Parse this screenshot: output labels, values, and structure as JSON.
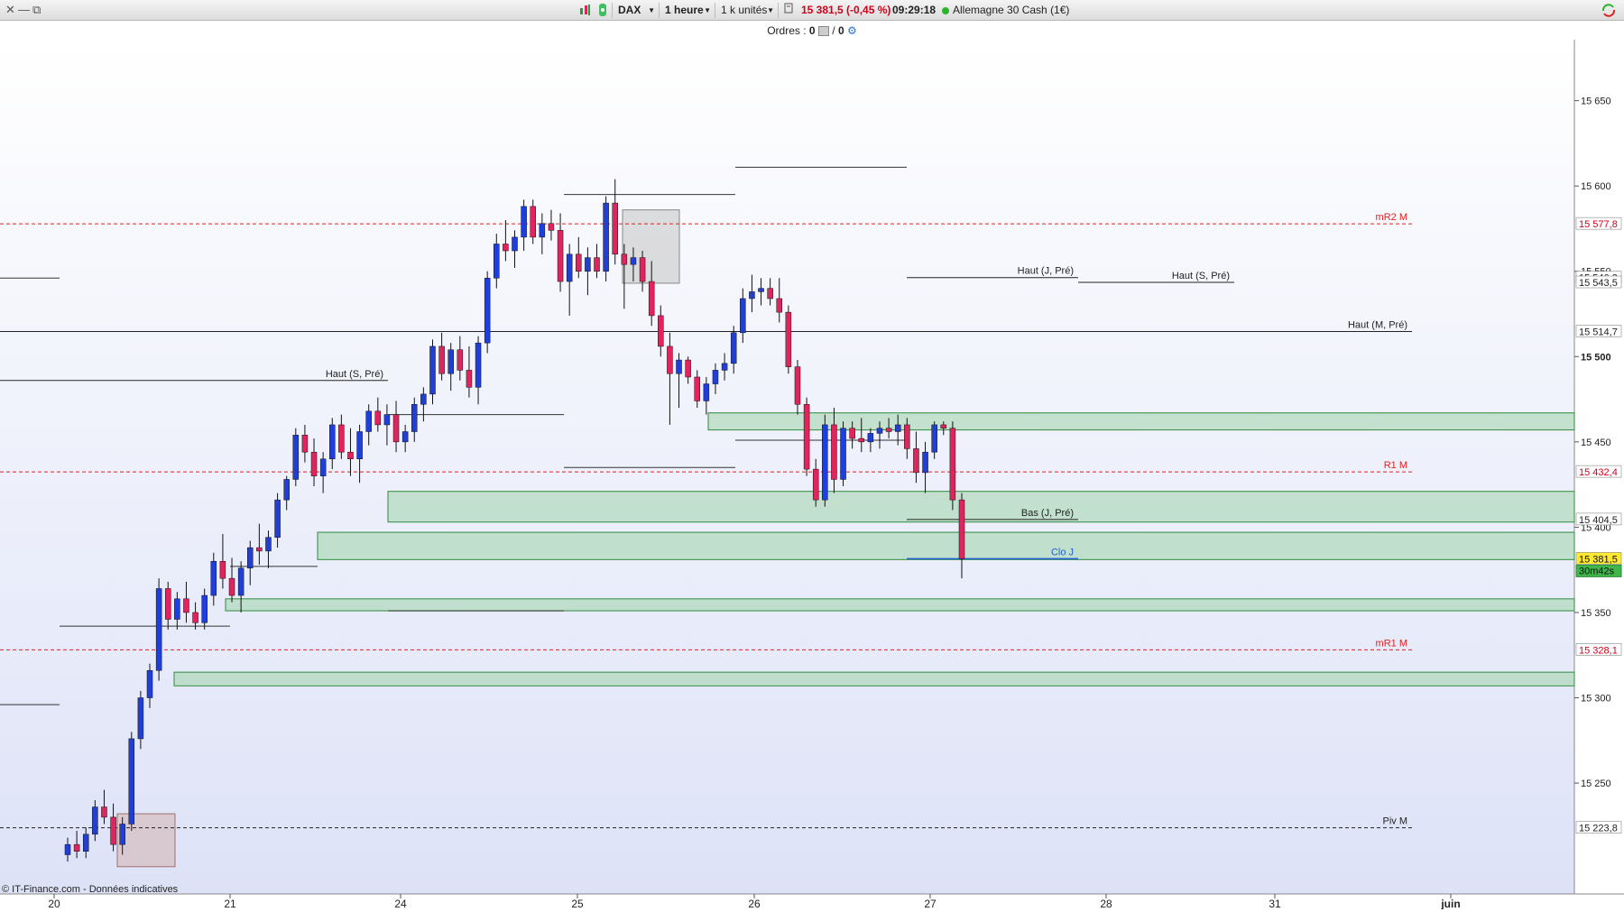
{
  "toolbar": {
    "close_glyph": "✕",
    "minimize_glyph": "—",
    "restore_glyph": "⧉",
    "symbol": "DAX",
    "timeframe": "1 heure",
    "units": "1 k unités",
    "last_quote": "15 381,5 (-0,45 %)",
    "time": "09:29:18",
    "instrument": "Allemagne 30 Cash (1€)",
    "status_color": "#2bb42b",
    "negative_color": "#d0021b"
  },
  "orders": {
    "label": "Ordres :",
    "count_a": "0",
    "separator": "/",
    "count_b": "0"
  },
  "copyright": "© IT-Finance.com - Données indicatives",
  "colors": {
    "bull": "#1f3fd8",
    "bear": "#e0245e",
    "zone_fill": "#9fd3a8",
    "zone_stroke": "#2e8b3e",
    "pivot": "#e02020",
    "level": "#222222",
    "close": "#1f5fd8",
    "bg_top": "#ffffff",
    "bg_bottom": "#dde2f7"
  },
  "chart_data": {
    "type": "candlestick",
    "instrument": "DAX",
    "timeframe": "1 heure",
    "x_tick_labels": [
      "20",
      "21",
      "24",
      "25",
      "26",
      "27",
      "28",
      "31",
      "juin"
    ],
    "y_tick_labels": [
      "15 650",
      "15 600",
      "15 550",
      "15 500",
      "15 450",
      "15 400",
      "15 350",
      "15 300",
      "15 250"
    ],
    "y_axis_visible_range": [
      15200,
      15670
    ],
    "price_tags": [
      {
        "value": "15 577,8",
        "kind": "pivot"
      },
      {
        "value": "15 546,3",
        "kind": "level"
      },
      {
        "value": "15 543,5",
        "kind": "level"
      },
      {
        "value": "15 514,7",
        "kind": "level"
      },
      {
        "value": "15 432,4",
        "kind": "pivot"
      },
      {
        "value": "15 404,5",
        "kind": "level"
      },
      {
        "value": "15 381,5",
        "kind": "last"
      },
      {
        "value": "15 328,1",
        "kind": "pivot"
      },
      {
        "value": "15 223,8",
        "kind": "level"
      }
    ],
    "countdown": "30m42s",
    "levels": [
      {
        "label": "mR2 M",
        "price": 15577.8,
        "style": "pivot"
      },
      {
        "label": "R1 M",
        "price": 15432.4,
        "style": "pivot"
      },
      {
        "label": "mR1 M",
        "price": 15328.1,
        "style": "pivot"
      },
      {
        "label": "Piv M",
        "price": 15223.8,
        "style": "level"
      },
      {
        "label": "Haut (M, Pré)",
        "price": 15514.7,
        "style": "level"
      },
      {
        "label": "Haut (J, Pré)",
        "price": 15546.3,
        "style": "level"
      },
      {
        "label": "Haut (S, Pré)",
        "price": 15543.5,
        "style": "level"
      },
      {
        "label": "Haut (S, Pré)",
        "price": 15486,
        "style": "level"
      },
      {
        "label": "Bas (J, Pré)",
        "price": 15404.5,
        "style": "level"
      },
      {
        "label": "Clo J",
        "price": 15381.5,
        "style": "close"
      }
    ],
    "zones": [
      {
        "from": 15457,
        "to": 15467
      },
      {
        "from": 15403,
        "to": 15421
      },
      {
        "from": 15381,
        "to": 15397
      },
      {
        "from": 15351,
        "to": 15358
      },
      {
        "from": 15307,
        "to": 15315
      }
    ],
    "ohlc": [
      [
        15208,
        15218,
        15204,
        15214
      ],
      [
        15214,
        15222,
        15206,
        15210
      ],
      [
        15210,
        15224,
        15206,
        15220
      ],
      [
        15220,
        15240,
        15216,
        15236
      ],
      [
        15236,
        15246,
        15226,
        15230
      ],
      [
        15230,
        15238,
        15210,
        15214
      ],
      [
        15214,
        15230,
        15208,
        15226
      ],
      [
        15226,
        15280,
        15222,
        15276
      ],
      [
        15276,
        15304,
        15270,
        15300
      ],
      [
        15300,
        15320,
        15294,
        15316
      ],
      [
        15316,
        15370,
        15310,
        15364
      ],
      [
        15364,
        15368,
        15340,
        15346
      ],
      [
        15346,
        15362,
        15340,
        15358
      ],
      [
        15358,
        15368,
        15344,
        15350
      ],
      [
        15350,
        15356,
        15340,
        15344
      ],
      [
        15344,
        15364,
        15340,
        15360
      ],
      [
        15360,
        15385,
        15354,
        15380
      ],
      [
        15380,
        15396,
        15364,
        15370
      ],
      [
        15370,
        15382,
        15356,
        15360
      ],
      [
        15360,
        15380,
        15350,
        15376
      ],
      [
        15376,
        15392,
        15366,
        15388
      ],
      [
        15388,
        15402,
        15378,
        15386
      ],
      [
        15386,
        15398,
        15376,
        15394
      ],
      [
        15394,
        15420,
        15388,
        15416
      ],
      [
        15416,
        15430,
        15410,
        15428
      ],
      [
        15428,
        15458,
        15424,
        15454
      ],
      [
        15454,
        15460,
        15438,
        15444
      ],
      [
        15444,
        15452,
        15424,
        15430
      ],
      [
        15430,
        15444,
        15420,
        15440
      ],
      [
        15440,
        15464,
        15434,
        15460
      ],
      [
        15460,
        15466,
        15440,
        15444
      ],
      [
        15444,
        15458,
        15430,
        15440
      ],
      [
        15440,
        15460,
        15426,
        15456
      ],
      [
        15456,
        15472,
        15448,
        15468
      ],
      [
        15468,
        15476,
        15456,
        15460
      ],
      [
        15460,
        15472,
        15448,
        15466
      ],
      [
        15466,
        15474,
        15444,
        15450
      ],
      [
        15450,
        15460,
        15444,
        15456
      ],
      [
        15456,
        15476,
        15450,
        15472
      ],
      [
        15472,
        15482,
        15462,
        15478
      ],
      [
        15478,
        15510,
        15472,
        15506
      ],
      [
        15506,
        15514,
        15486,
        15490
      ],
      [
        15490,
        15508,
        15480,
        15504
      ],
      [
        15504,
        15512,
        15486,
        15492
      ],
      [
        15492,
        15506,
        15476,
        15482
      ],
      [
        15482,
        15512,
        15472,
        15508
      ],
      [
        15508,
        15550,
        15502,
        15546
      ],
      [
        15546,
        15572,
        15540,
        15566
      ],
      [
        15566,
        15580,
        15556,
        15562
      ],
      [
        15562,
        15574,
        15552,
        15570
      ],
      [
        15570,
        15592,
        15562,
        15588
      ],
      [
        15588,
        15592,
        15566,
        15570
      ],
      [
        15570,
        15584,
        15560,
        15578
      ],
      [
        15578,
        15586,
        15568,
        15574
      ],
      [
        15574,
        15584,
        15538,
        15544
      ],
      [
        15544,
        15566,
        15524,
        15560
      ],
      [
        15560,
        15570,
        15546,
        15550
      ],
      [
        15550,
        15564,
        15536,
        15558
      ],
      [
        15558,
        15566,
        15546,
        15550
      ],
      [
        15550,
        15594,
        15544,
        15590
      ],
      [
        15590,
        15604,
        15554,
        15560
      ],
      [
        15560,
        15566,
        15528,
        15554
      ],
      [
        15554,
        15564,
        15544,
        15558
      ],
      [
        15558,
        15562,
        15538,
        15544
      ],
      [
        15544,
        15556,
        15518,
        15524
      ],
      [
        15524,
        15530,
        15500,
        15506
      ],
      [
        15506,
        15514,
        15460,
        15490
      ],
      [
        15490,
        15502,
        15470,
        15498
      ],
      [
        15498,
        15500,
        15484,
        15488
      ],
      [
        15488,
        15492,
        15470,
        15474
      ],
      [
        15474,
        15488,
        15466,
        15484
      ],
      [
        15484,
        15496,
        15478,
        15492
      ],
      [
        15492,
        15502,
        15486,
        15496
      ],
      [
        15496,
        15518,
        15490,
        15514
      ],
      [
        15514,
        15540,
        15508,
        15534
      ],
      [
        15534,
        15548,
        15526,
        15538
      ],
      [
        15538,
        15546,
        15530,
        15540
      ],
      [
        15540,
        15546,
        15530,
        15534
      ],
      [
        15534,
        15546,
        15520,
        15526
      ],
      [
        15526,
        15530,
        15490,
        15494
      ],
      [
        15494,
        15498,
        15466,
        15472
      ],
      [
        15472,
        15476,
        15430,
        15434
      ],
      [
        15434,
        15440,
        15412,
        15416
      ],
      [
        15416,
        15466,
        15412,
        15460
      ],
      [
        15460,
        15470,
        15420,
        15428
      ],
      [
        15428,
        15462,
        15424,
        15458
      ],
      [
        15458,
        15462,
        15446,
        15452
      ],
      [
        15452,
        15464,
        15444,
        15450
      ],
      [
        15450,
        15458,
        15444,
        15455
      ],
      [
        15455,
        15462,
        15446,
        15458
      ],
      [
        15458,
        15464,
        15452,
        15456
      ],
      [
        15456,
        15466,
        15448,
        15460
      ],
      [
        15460,
        15464,
        15440,
        15446
      ],
      [
        15446,
        15456,
        15426,
        15432
      ],
      [
        15432,
        15450,
        15420,
        15444
      ],
      [
        15444,
        15462,
        15440,
        15460
      ],
      [
        15460,
        15462,
        15454,
        15458
      ],
      [
        15458,
        15462,
        15410,
        15416
      ],
      [
        15416,
        15420,
        15370,
        15381.5
      ]
    ]
  }
}
